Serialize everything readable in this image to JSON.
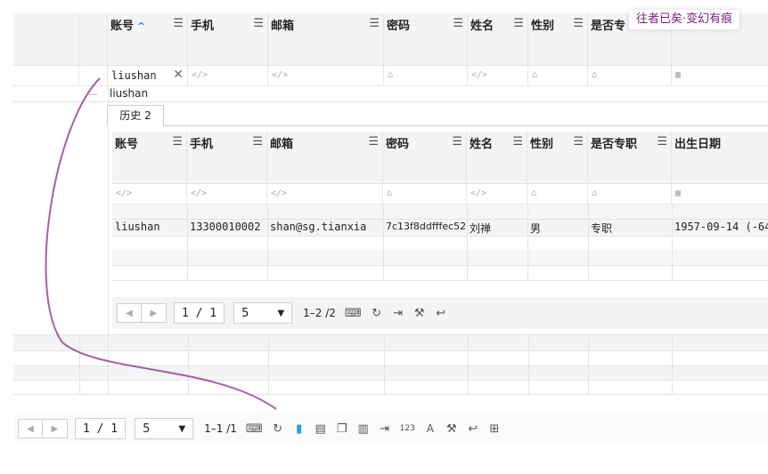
{
  "watermark": "往者已矣·变幻有痕",
  "columns": [
    "账号",
    "手机",
    "邮箱",
    "密码",
    "姓名",
    "性别",
    "是否专职",
    "出生日期"
  ],
  "main_grid": {
    "header_visible_columns": [
      "账号",
      "手机",
      "邮箱",
      "密码",
      "姓名",
      "性别",
      "是否专"
    ],
    "filter_account_value": "liushan",
    "filter_clear_symbol": "✕",
    "group_row_label": "liushan"
  },
  "detail": {
    "tab_label": "历史 2",
    "rows": [
      {
        "account": "liushan",
        "phone": "13300010002",
        "email": "shan@sg.tianxia",
        "password": "7c13f8ddfffec52",
        "name": "刘禅",
        "gender": "男",
        "fulltime": "专职",
        "birth": "1957-09-14 (-64"
      }
    ],
    "pager": {
      "page": "1  /  1",
      "page_size": "5",
      "range": "1–2 /2"
    }
  },
  "main_pager": {
    "page": "1  /  1",
    "page_size": "5",
    "range": "1–1 /1",
    "num_label": "123",
    "font_label": "A"
  },
  "icons": {
    "menu": "☰",
    "sort_up": "^",
    "code": "</>",
    "lock": "⌂",
    "calendar": "▦",
    "prev": "◀",
    "next": "▶",
    "dropdown": "▼"
  }
}
